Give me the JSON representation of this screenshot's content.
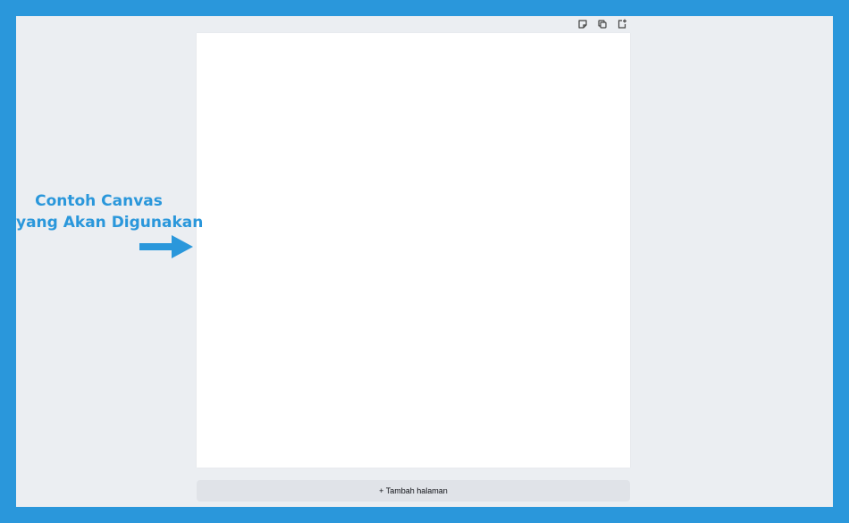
{
  "page_toolbar": {
    "icons": [
      "note-icon",
      "duplicate-icon",
      "add-page-icon"
    ]
  },
  "add_page_button": {
    "label": "+ Tambah halaman"
  },
  "annotation": {
    "line1": "Contoh Canvas",
    "line2": "yang Akan Digunakan"
  },
  "colors": {
    "frame": "#2a97db",
    "workspace": "#ebeef2",
    "page": "#ffffff",
    "button": "#e0e3e8",
    "annotation": "#2a97db"
  }
}
